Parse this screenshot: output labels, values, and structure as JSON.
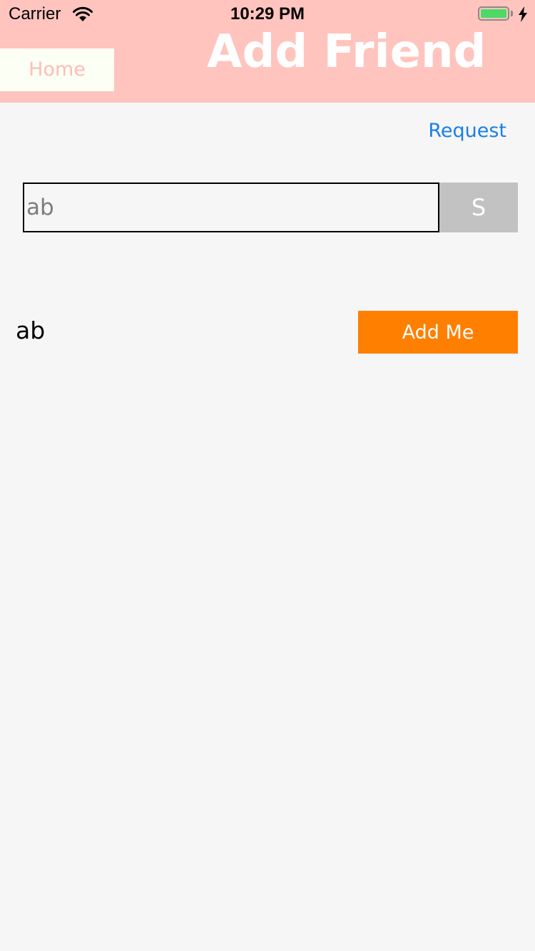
{
  "status_bar": {
    "carrier": "Carrier",
    "time": "10:29 PM",
    "battery_level": 1.0,
    "charging": true
  },
  "header": {
    "back_label": "Home",
    "title": "Add Friend",
    "background_color": "#ffc4be"
  },
  "toolbar": {
    "request_label": "Request"
  },
  "search": {
    "value": "ab",
    "button_label": "S"
  },
  "results": [
    {
      "name": "ab",
      "action_label": "Add Me"
    }
  ],
  "colors": {
    "accent": "#ff7f00",
    "link": "#1a7fe8",
    "battery": "#4cd964"
  },
  "icons": [
    "wifi-icon",
    "battery-icon",
    "charging-bolt-icon"
  ]
}
